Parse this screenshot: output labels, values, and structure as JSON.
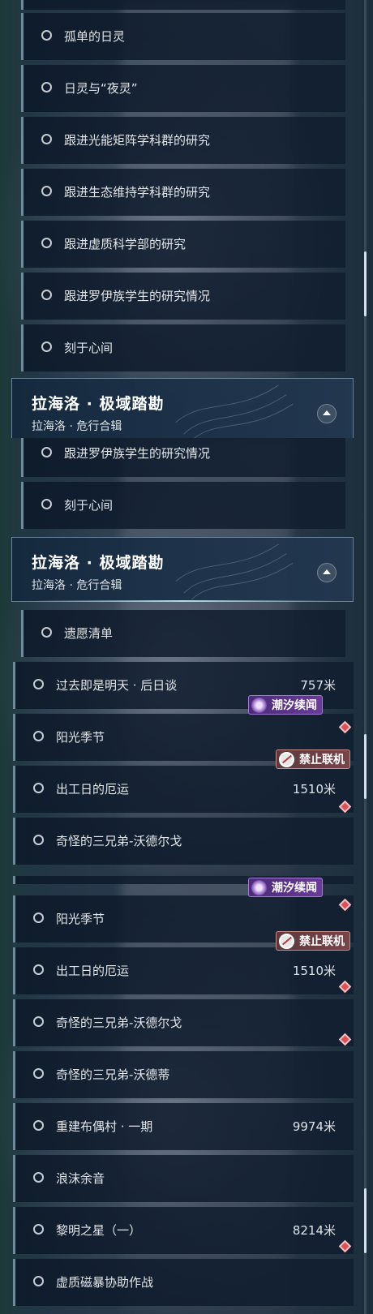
{
  "panel1": {
    "rows": [
      {
        "label": "孤单的日灵"
      },
      {
        "label": "日灵与“夜灵”"
      },
      {
        "label": "跟进光能矩阵学科群的研究"
      },
      {
        "label": "跟进生态维持学科群的研究"
      },
      {
        "label": "跟进虚质科学部的研究"
      },
      {
        "label": "跟进罗伊族学生的研究情况"
      },
      {
        "label": "刻于心间"
      }
    ],
    "section": {
      "title": "拉海洛 · 极域踏勘",
      "subtitle": "拉海洛 · 危行合辑"
    }
  },
  "panel2": {
    "rows_top": [
      {
        "label": "跟进罗伊族学生的研究情况"
      },
      {
        "label": "刻于心间"
      }
    ],
    "section": {
      "title": "拉海洛 · 极域踏勘",
      "subtitle": "拉海洛 · 危行合辑"
    },
    "quest_rows": [
      {
        "label": "遗愿清单"
      },
      {
        "label": "过去即是明天 · 后日谈",
        "distance": "757米"
      },
      {
        "label": "阳光季节"
      },
      {
        "label": "出工日的厄运",
        "distance": "1510米"
      },
      {
        "label": "奇怪的三兄弟-沃德尔戈"
      }
    ],
    "badges": {
      "tide": "潮汐续闻",
      "nolink": "禁止联机"
    }
  },
  "panel3": {
    "quest_rows": [
      {
        "label": "阳光季节"
      },
      {
        "label": "出工日的厄运",
        "distance": "1510米"
      },
      {
        "label": "奇怪的三兄弟-沃德尔戈"
      },
      {
        "label": "奇怪的三兄弟-沃德蒂"
      },
      {
        "label": "重建布偶村 · 一期",
        "distance": "9974米"
      },
      {
        "label": "浪沫余音"
      },
      {
        "label": "黎明之星（一）",
        "distance": "8214米"
      },
      {
        "label": "虚质磁暴协助作战"
      }
    ],
    "badges": {
      "tide": "潮汐续闻",
      "nolink": "禁止联机"
    }
  },
  "icons": {
    "circle": "status-circle-icon",
    "gem": "diamond-marker-icon",
    "collapse": "collapse-arrow-icon"
  },
  "colors": {
    "tide_badge": "#6a3b98",
    "nolink_badge": "#7a4448",
    "marker": "#d8525a"
  }
}
